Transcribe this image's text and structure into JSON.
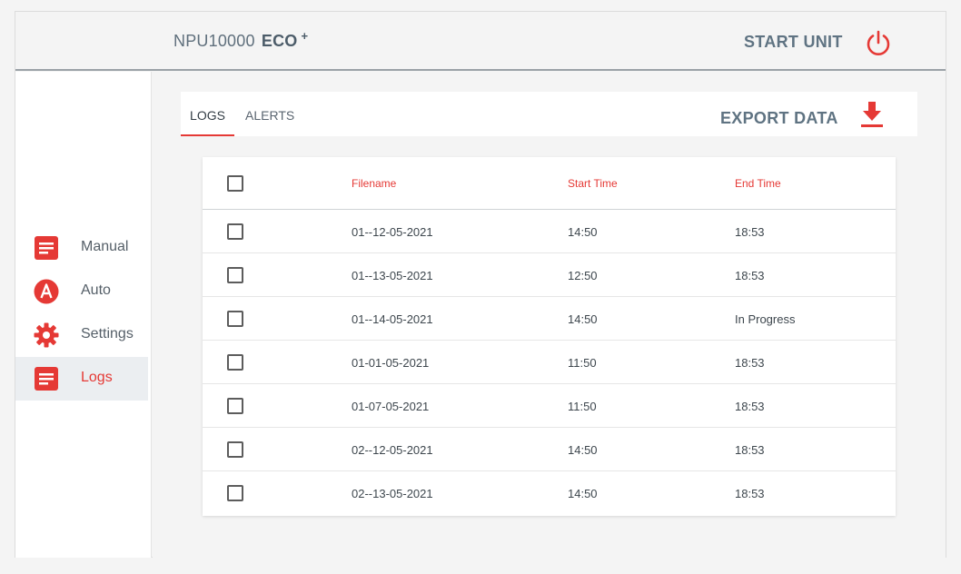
{
  "header": {
    "model": "NPU10000",
    "edition": "ECO",
    "edition_suffix": "+",
    "start_unit_label": "START UNIT",
    "power_icon": "power-icon"
  },
  "sidebar": {
    "items": [
      {
        "label": "Manual",
        "icon": "document-icon"
      },
      {
        "label": "Auto",
        "icon": "auto-a-icon"
      },
      {
        "label": "Settings",
        "icon": "gear-icon"
      },
      {
        "label": "Logs",
        "icon": "document-icon",
        "active": true
      }
    ]
  },
  "tabs": [
    {
      "label": "LOGS",
      "active": true
    },
    {
      "label": "ALERTS",
      "active": false
    }
  ],
  "export": {
    "label": "EXPORT DATA",
    "icon": "download-icon"
  },
  "table": {
    "columns": [
      "Filename",
      "Start Time",
      "End Time"
    ],
    "rows": [
      {
        "filename": "01--12-05-2021",
        "start": "14:50",
        "end": "18:53"
      },
      {
        "filename": "01--13-05-2021",
        "start": "12:50",
        "end": "18:53"
      },
      {
        "filename": "01--14-05-2021",
        "start": "14:50",
        "end": "In Progress"
      },
      {
        "filename": "01-01-05-2021",
        "start": "11:50",
        "end": "18:53"
      },
      {
        "filename": "01-07-05-2021",
        "start": "11:50",
        "end": "18:53"
      },
      {
        "filename": "02--12-05-2021",
        "start": "14:50",
        "end": "18:53"
      },
      {
        "filename": "02--13-05-2021",
        "start": "14:50",
        "end": "18:53"
      }
    ]
  },
  "colors": {
    "accent": "#e53935",
    "text_muted": "#5f7382"
  }
}
